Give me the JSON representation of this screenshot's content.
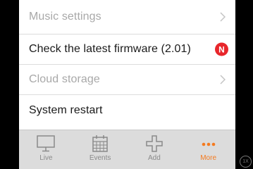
{
  "menu": {
    "items": [
      {
        "label": "Music settings",
        "state": "disabled",
        "trailing": "chevron-right-icon"
      },
      {
        "label": "Check the latest firmware (2.01)",
        "state": "enabled",
        "trailing": "new-badge",
        "badge_text": "N"
      },
      {
        "label": "Cloud storage",
        "state": "disabled",
        "trailing": "chevron-right-icon"
      },
      {
        "label": "System restart",
        "state": "enabled",
        "trailing": null
      }
    ]
  },
  "tabbar": {
    "tabs": [
      {
        "label": "Live",
        "icon": "monitor-icon",
        "active": false
      },
      {
        "label": "Events",
        "icon": "calendar-icon",
        "active": false
      },
      {
        "label": "Add",
        "icon": "plus-icon",
        "active": false
      },
      {
        "label": "More",
        "icon": "more-dots-icon",
        "active": true
      }
    ]
  },
  "overlay": {
    "zoom_badge": "1X"
  },
  "colors": {
    "accent": "#f47a1f",
    "badge": "#e8262b",
    "tab_bar_bg": "#dcdcdc",
    "disabled_text": "#a8a8a8",
    "tab_inactive": "#8a8a8a"
  }
}
